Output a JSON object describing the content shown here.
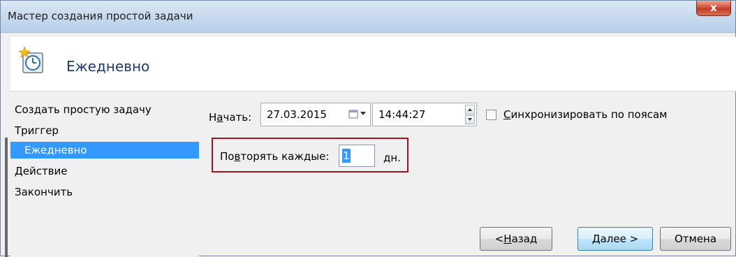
{
  "window": {
    "title": "Мастер создания простой задачи",
    "close_glyph": "x"
  },
  "header": {
    "title": "Ежедневно",
    "icon": "task-clock-icon"
  },
  "nav": {
    "items": [
      {
        "label": "Создать простую задачу",
        "selected": false
      },
      {
        "label": "Триггер",
        "selected": false
      },
      {
        "label": "Ежедневно",
        "selected": true
      },
      {
        "label": "Действие",
        "selected": false
      },
      {
        "label": "Закончить",
        "selected": false
      }
    ]
  },
  "form": {
    "start_label_pre": "Н",
    "start_label_ul": "а",
    "start_label_post": "чать:",
    "start_date": "27.03.2015",
    "start_time": "14:44:27",
    "sync_label_ul": "С",
    "sync_label_post": "инхронизировать по поясам",
    "sync_checked": false,
    "repeat_label_pre": "По",
    "repeat_label_ul": "в",
    "repeat_label_post": "торять каждые:",
    "repeat_value": "1",
    "repeat_unit": "дн."
  },
  "buttons": {
    "back_pre": "< ",
    "back_ul": "Н",
    "back_post": "азад",
    "next_ul": "Д",
    "next_post": "алее >",
    "cancel": "Отмена"
  },
  "colors": {
    "highlight_border": "#a3131f",
    "nav_selected": "#3399ff",
    "header_title": "#1e3a6e"
  }
}
